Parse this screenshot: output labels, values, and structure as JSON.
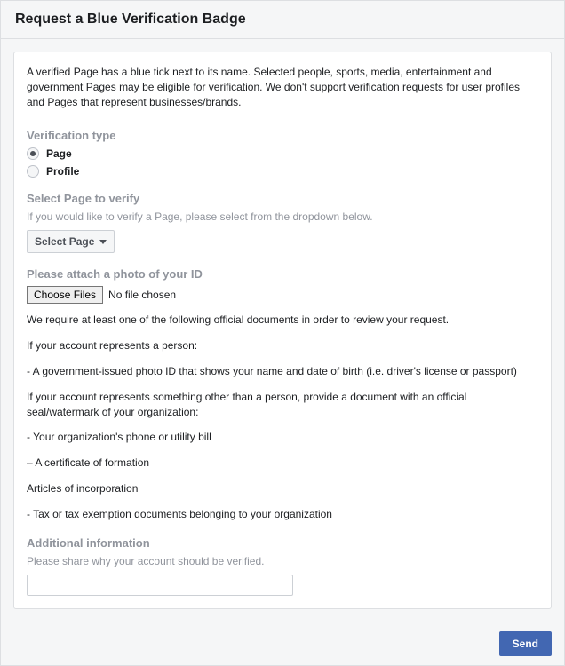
{
  "header": {
    "title": "Request a Blue Verification Badge"
  },
  "intro": "A verified Page has a blue tick next to its name. Selected people, sports, media, entertainment and government Pages may be eligible for verification. We don't support verification requests for user profiles and Pages that represent businesses/brands.",
  "verificationType": {
    "label": "Verification type",
    "options": {
      "page": "Page",
      "profile": "Profile"
    }
  },
  "selectPage": {
    "label": "Select Page to verify",
    "hint": "If you would like to verify a Page, please select from the dropdown below.",
    "buttonLabel": "Select Page"
  },
  "attachId": {
    "label": "Please attach a photo of your ID",
    "chooseFiles": "Choose Files",
    "noFile": "No file chosen",
    "requireIntro": "We require at least one of the following official documents in order to review your request.",
    "personLead": "If your account represents a person:",
    "personItem": "- A government-issued photo ID that shows your name and date of birth (i.e. driver's license or passport)",
    "orgLead": "If your account represents something other than a person, provide a document with an official seal/watermark of your organization:",
    "orgItem1": "- Your organization's phone or utility bill",
    "orgItem2": "– A certificate of formation",
    "orgItem3": "Articles of incorporation",
    "orgItem4": "- Tax or tax exemption documents belonging to your organization"
  },
  "additional": {
    "label": "Additional information",
    "hint": "Please share why your account should be verified."
  },
  "footer": {
    "send": "Send"
  }
}
